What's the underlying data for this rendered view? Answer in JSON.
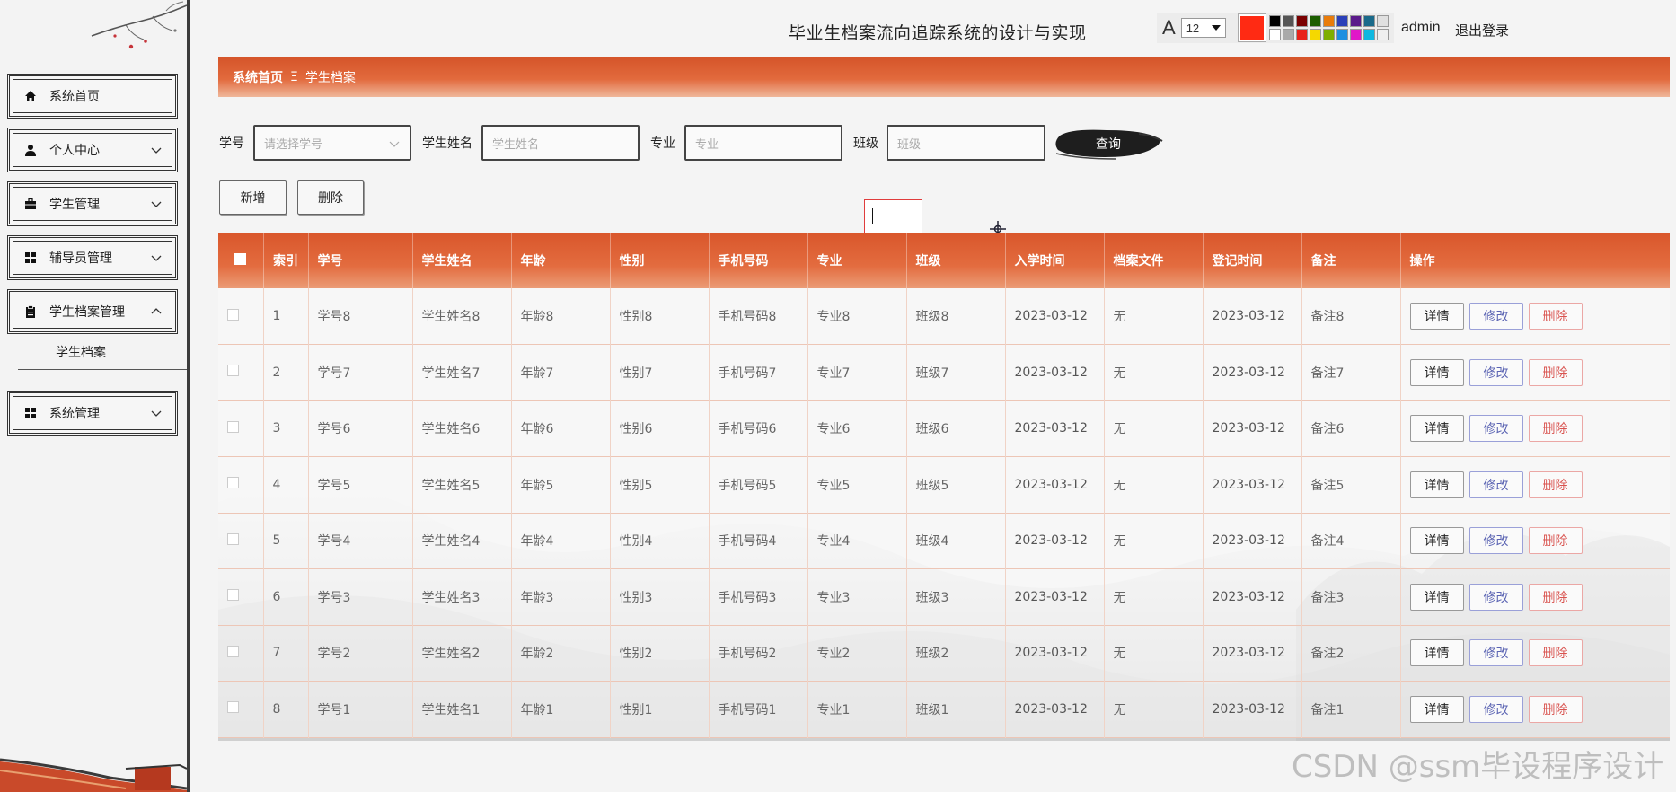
{
  "header": {
    "title": "毕业生档案流向追踪系统的设计与实现",
    "user": "admin",
    "logout": "退出登录"
  },
  "font_tool": {
    "letter": "A",
    "size": "12",
    "current_color": "#ff2a13",
    "palette": [
      "#000000",
      "#555555",
      "#7a0000",
      "#1c5d00",
      "#e87b0a",
      "#2a3fb8",
      "#5a1a8a",
      "#1a6a8a",
      "#e0e0e0",
      "#ffffff",
      "#aaaaaa",
      "#e8221a",
      "#f5d800",
      "#7fae00",
      "#1d8fe0",
      "#e018c8",
      "#10b8e0",
      "#f0f0f0"
    ]
  },
  "sidebar": {
    "items": [
      {
        "label": "系统首页",
        "icon": "home-icon"
      },
      {
        "label": "个人中心",
        "icon": "user-icon"
      },
      {
        "label": "学生管理",
        "icon": "briefcase-icon"
      },
      {
        "label": "辅导员管理",
        "icon": "grid-icon"
      },
      {
        "label": "学生档案管理",
        "icon": "clipboard-icon"
      },
      {
        "label": "系统管理",
        "icon": "grid-icon"
      }
    ],
    "submenu": "学生档案"
  },
  "breadcrumb": {
    "home": "系统首页",
    "sep": "Ξ",
    "current": "学生档案"
  },
  "search": {
    "xuehao_label": "学号",
    "xuehao_placeholder": "请选择学号",
    "name_label": "学生姓名",
    "name_placeholder": "学生姓名",
    "major_label": "专业",
    "major_placeholder": "专业",
    "class_label": "班级",
    "class_placeholder": "班级",
    "query": "查询"
  },
  "actions": {
    "add": "新增",
    "delete": "删除"
  },
  "table": {
    "index_header": "索引",
    "headers": [
      "学号",
      "学生姓名",
      "年龄",
      "性别",
      "手机号码",
      "专业",
      "班级",
      "入学时间",
      "档案文件",
      "登记时间",
      "备注",
      "操作"
    ],
    "op_labels": {
      "detail": "详情",
      "edit": "修改",
      "delete": "删除"
    },
    "rows": [
      [
        "1",
        "学号8",
        "学生姓名8",
        "年龄8",
        "性别8",
        "手机号码8",
        "专业8",
        "班级8",
        "2023-03-12",
        "无",
        "2023-03-12",
        "备注8"
      ],
      [
        "2",
        "学号7",
        "学生姓名7",
        "年龄7",
        "性别7",
        "手机号码7",
        "专业7",
        "班级7",
        "2023-03-12",
        "无",
        "2023-03-12",
        "备注7"
      ],
      [
        "3",
        "学号6",
        "学生姓名6",
        "年龄6",
        "性别6",
        "手机号码6",
        "专业6",
        "班级6",
        "2023-03-12",
        "无",
        "2023-03-12",
        "备注6"
      ],
      [
        "4",
        "学号5",
        "学生姓名5",
        "年龄5",
        "性别5",
        "手机号码5",
        "专业5",
        "班级5",
        "2023-03-12",
        "无",
        "2023-03-12",
        "备注5"
      ],
      [
        "5",
        "学号4",
        "学生姓名4",
        "年龄4",
        "性别4",
        "手机号码4",
        "专业4",
        "班级4",
        "2023-03-12",
        "无",
        "2023-03-12",
        "备注4"
      ],
      [
        "6",
        "学号3",
        "学生姓名3",
        "年龄3",
        "性别3",
        "手机号码3",
        "专业3",
        "班级3",
        "2023-03-12",
        "无",
        "2023-03-12",
        "备注3"
      ],
      [
        "7",
        "学号2",
        "学生姓名2",
        "年龄2",
        "性别2",
        "手机号码2",
        "专业2",
        "班级2",
        "2023-03-12",
        "无",
        "2023-03-12",
        "备注2"
      ],
      [
        "8",
        "学号1",
        "学生姓名1",
        "年龄1",
        "性别1",
        "手机号码1",
        "专业1",
        "班级1",
        "2023-03-12",
        "无",
        "2023-03-12",
        "备注1"
      ]
    ]
  },
  "watermark": "CSDN @ssm毕设程序设计"
}
